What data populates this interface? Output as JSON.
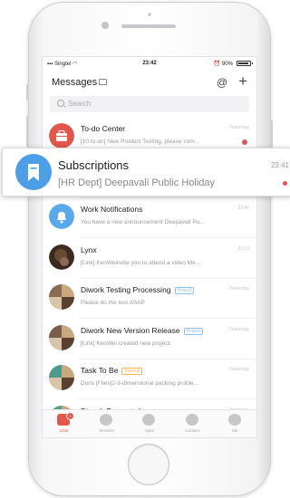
{
  "status_bar": {
    "carrier": "Singtel",
    "time": "23:42",
    "battery": "90%",
    "battery_level": 0.9
  },
  "header": {
    "title": "Messages"
  },
  "search": {
    "placeholder": "Search"
  },
  "conversations": [
    {
      "name": "To-do Center",
      "preview": "[10 to-do] New Product Testing, please com...",
      "time": "Yesterday",
      "unread": true,
      "avatar_color": "#e2574c",
      "icon": "briefcase-icon"
    },
    {
      "name": "Subscriptions",
      "preview": "[HR Dept] Deepavali Public Holiday",
      "time": "23:41",
      "unread": true,
      "avatar_color": "#4d9ee6",
      "icon": "bookmark-icon"
    },
    {
      "name": "Work Notifications",
      "preview": "You have a new announcement Deepavali Pu...",
      "time": "23:40",
      "unread": false,
      "avatar_color": "#5aa8ec",
      "icon": "bell-icon"
    },
    {
      "name": "Lynx",
      "preview": "[Link] KenWeinvite you to attend a video Me...",
      "time": "23:13",
      "unread": false,
      "avatar_color": "#6a4a35",
      "icon": "photo-avatar"
    },
    {
      "name": "Diwork Testing Processing",
      "tag": "Project",
      "preview": "Please do the test ASAP",
      "time": "Yesterday",
      "unread": false,
      "avatar_color": "#8a6a50",
      "icon": "group-avatar"
    },
    {
      "name": "Diwork New Version Release",
      "tag": "Project",
      "preview": "[Link] KenWei created new project",
      "time": "Yesterday",
      "unread": false,
      "avatar_color": "#7a5d4a",
      "icon": "group-avatar"
    },
    {
      "name": "Task To Be",
      "tag": "Internal",
      "preview": "Doris [Files]2-3-dimensional packing proble...",
      "time": "Yesterday",
      "unread": false,
      "avatar_color": "#4e9a8a",
      "icon": "group-avatar"
    },
    {
      "name": "Diwork Presentation",
      "preview": "",
      "time": "Yesterday",
      "unread": false,
      "avatar_color": "#5aa08a",
      "icon": "group-avatar"
    }
  ],
  "tabbar": [
    {
      "label": "Chat",
      "active": true,
      "badge": "1"
    },
    {
      "label": "Moment",
      "active": false
    },
    {
      "label": "Apps",
      "active": false
    },
    {
      "label": "Contact",
      "active": false
    },
    {
      "label": "Me",
      "active": false
    }
  ],
  "highlight": {
    "name": "Subscriptions",
    "preview": "[HR Dept] Deepavali Public Holiday",
    "time": "23:41",
    "unread": true
  },
  "colors": {
    "accent": "#e2574c",
    "blue": "#4d9ee6",
    "tag_blue": "#8cc2f2",
    "tag_orange": "#f5b35a"
  }
}
